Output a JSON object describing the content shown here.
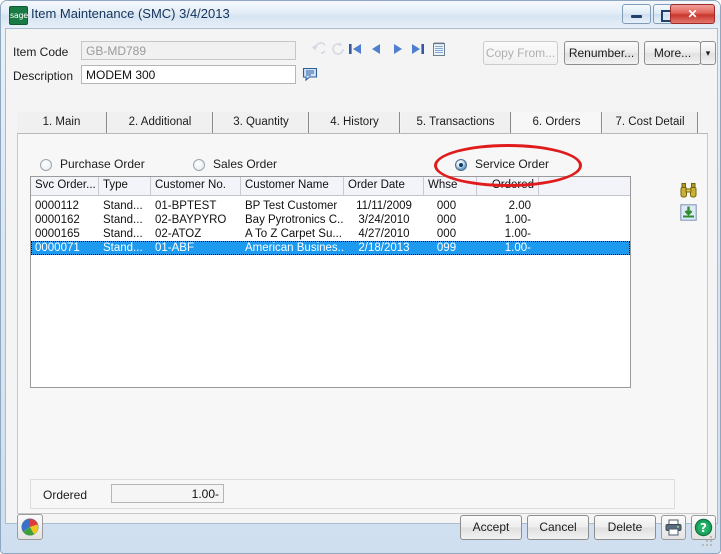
{
  "window": {
    "title": "Item Maintenance (SMC) 3/4/2013",
    "app_icon": "sage-logo-icon",
    "controls": {
      "minimize": "minimize-icon",
      "maximize": "maximize-icon",
      "close": "✕"
    }
  },
  "header": {
    "item_code_label": "Item Code",
    "item_code_value": "GB-MD789",
    "item_code_placeholder": "",
    "description_label": "Description",
    "description_value": "MODEM 300",
    "description_placeholder": "",
    "comment_icon": "comment-bubble-icon",
    "nav": [
      {
        "name": "undo-icon",
        "glyph": "↶",
        "enabled": false
      },
      {
        "name": "refresh-icon",
        "glyph": "⟳",
        "enabled": false
      },
      {
        "name": "first-record-icon",
        "glyph": "⏮",
        "enabled": true
      },
      {
        "name": "previous-record-icon",
        "glyph": "◀",
        "enabled": true
      },
      {
        "name": "next-record-icon",
        "glyph": "▶",
        "enabled": true
      },
      {
        "name": "last-record-icon",
        "glyph": "⏭",
        "enabled": true
      },
      {
        "name": "memo-icon",
        "glyph": "☰",
        "enabled": true
      }
    ],
    "buttons": {
      "copy_from": "Copy From...",
      "copy_from_enabled": false,
      "renumber": "Renumber...",
      "more": "More...",
      "more_dropdown": "▾"
    }
  },
  "tabs": [
    {
      "label": "1. Main",
      "selected": false
    },
    {
      "label": "2. Additional",
      "selected": false
    },
    {
      "label": "3. Quantity",
      "selected": false
    },
    {
      "label": "4. History",
      "selected": false
    },
    {
      "label": "5. Transactions",
      "selected": false
    },
    {
      "label": "6. Orders",
      "selected": true
    },
    {
      "label": "7. Cost Detail",
      "selected": false
    }
  ],
  "orders_tab": {
    "order_type_options": [
      {
        "label": "Purchase Order",
        "selected": false
      },
      {
        "label": "Sales Order",
        "selected": false
      },
      {
        "label": "Service Order",
        "selected": true
      }
    ],
    "grid": {
      "columns": [
        "Svc Order...",
        "Type",
        "Customer No.",
        "Customer Name",
        "Order Date",
        "Whse",
        "Ordered"
      ],
      "rows": [
        {
          "svc_order": "0000112",
          "type": "Stand...",
          "customer_no": "01-BPTEST",
          "customer_name": "BP Test Customer",
          "order_date": "11/11/2009",
          "whse": "000",
          "ordered": "2.00",
          "selected": false
        },
        {
          "svc_order": "0000162",
          "type": "Stand...",
          "customer_no": "02-BAYPYRO",
          "customer_name": "Bay Pyrotronics C...",
          "order_date": "3/24/2010",
          "whse": "000",
          "ordered": "1.00-",
          "selected": false
        },
        {
          "svc_order": "0000165",
          "type": "Stand...",
          "customer_no": "02-ATOZ",
          "customer_name": "A To Z Carpet Su...",
          "order_date": "4/27/2010",
          "whse": "000",
          "ordered": "1.00-",
          "selected": false
        },
        {
          "svc_order": "0000071",
          "type": "Stand...",
          "customer_no": "01-ABF",
          "customer_name": "American Busines...",
          "order_date": "2/18/2013",
          "whse": "099",
          "ordered": "1.00-",
          "selected": true
        }
      ]
    },
    "side_tools": [
      {
        "name": "binoculars-search-icon"
      },
      {
        "name": "export-to-excel-icon"
      }
    ],
    "totals": {
      "ordered_label": "Ordered",
      "ordered_value": "1.00-"
    }
  },
  "footer": {
    "business_insights_icon": "business-insights-icon",
    "accept": "Accept",
    "cancel": "Cancel",
    "delete": "Delete",
    "print_icon": "printer-icon",
    "help_icon": "help-question-icon"
  },
  "annotation": {
    "shape": "red-ellipse-highlight",
    "target": "Service Order",
    "color": "#e01b1b"
  },
  "colors": {
    "selection_blue": "#1c9af0",
    "annotation_red": "#e01b1b",
    "title_text": "#13335c",
    "sage_green": "#1a7a43"
  }
}
